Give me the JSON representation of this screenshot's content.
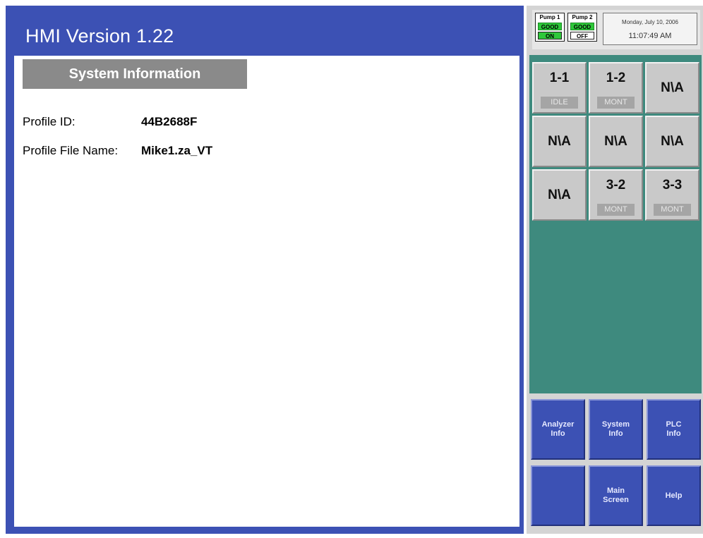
{
  "header": {
    "title": "HMI Version 1.22"
  },
  "section": {
    "title": "System Information",
    "fields": [
      {
        "label": "Profile ID:",
        "value": "44B2688F"
      },
      {
        "label": "Profile File Name:",
        "value": "Mike1.za_VT"
      }
    ]
  },
  "pumps": [
    {
      "name": "Pump 1",
      "health": "GOOD",
      "state": "ON"
    },
    {
      "name": "Pump 2",
      "health": "GOOD",
      "state": "OFF"
    }
  ],
  "clock": {
    "date": "Monday, July 10, 2006",
    "time": "11:07:49 AM"
  },
  "zones": [
    {
      "label": "1-1",
      "status": "IDLE"
    },
    {
      "label": "1-2",
      "status": "MONT"
    },
    {
      "label": "N\\A"
    },
    {
      "label": "N\\A"
    },
    {
      "label": "N\\A"
    },
    {
      "label": "N\\A"
    },
    {
      "label": "N\\A"
    },
    {
      "label": "3-2",
      "status": "MONT"
    },
    {
      "label": "3-3",
      "status": "MONT"
    }
  ],
  "nav": {
    "analyzer_info": "Analyzer\nInfo",
    "system_info": "System\nInfo",
    "plc_info": "PLC\nInfo",
    "blank": "",
    "main_screen": "Main\nScreen",
    "help": "Help"
  },
  "colors": {
    "panel_blue": "#3c51b4",
    "zone_background": "#3e8a7e",
    "good_green": "#2ec83a",
    "header_gray": "#8a8a8a"
  }
}
